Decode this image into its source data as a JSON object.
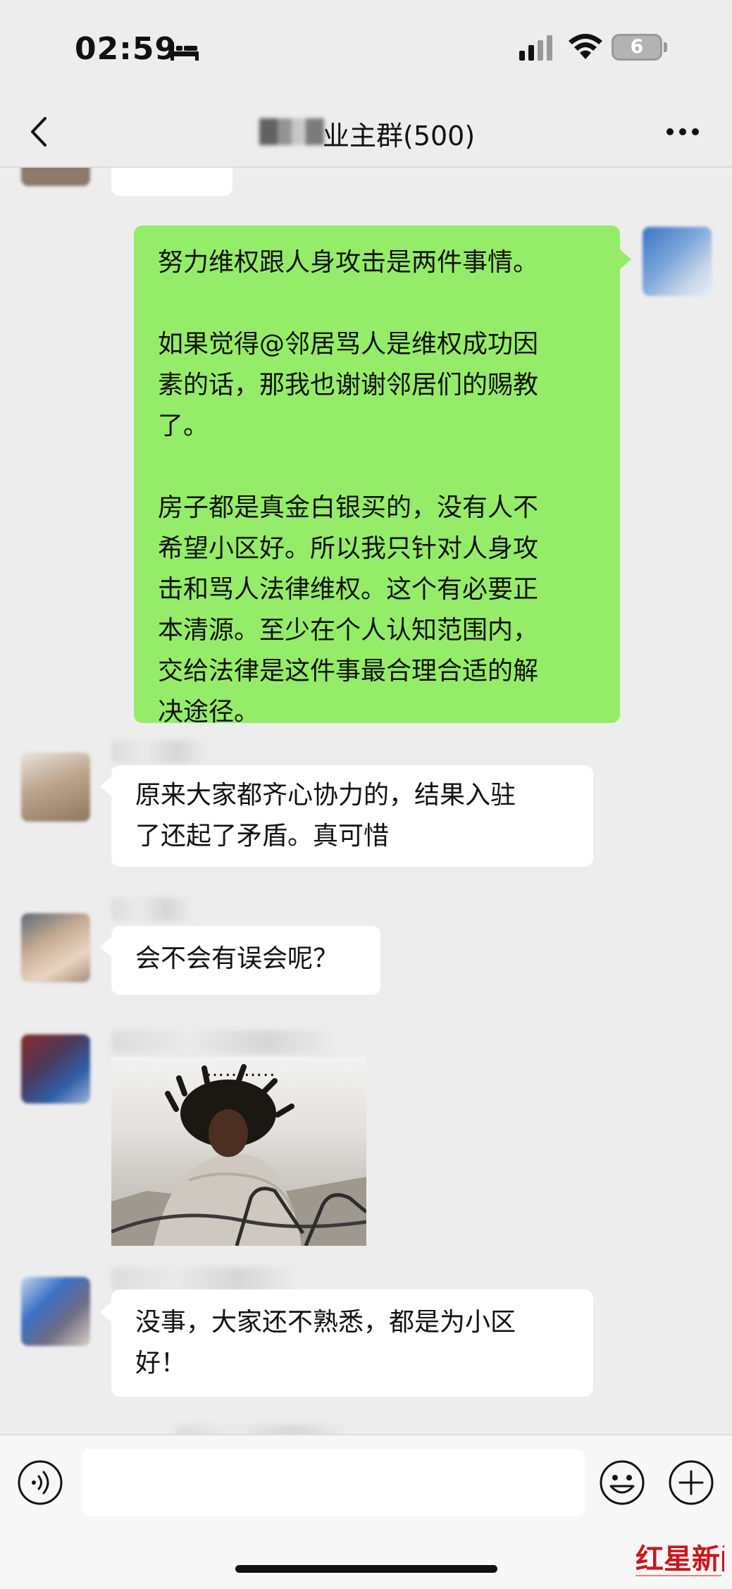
{
  "status_bar": {
    "time": "02:59",
    "battery": "6",
    "icons": [
      "bed-icon",
      "signal-icon",
      "wifi-icon",
      "battery-icon"
    ]
  },
  "nav": {
    "title": "业主群(500)",
    "icons": [
      "back-icon",
      "more-icon"
    ]
  },
  "messages": [
    {
      "side": "right",
      "type": "text",
      "paragraphs": [
        "努力维权跟人身攻击是两件事情。",
        "如果觉得@邻居骂人是维权成功因\n素的话，那我也谢谢邻居们的赐教\n了。",
        "房子都是真金白银买的，没有人不\n希望小区好。所以我只针对人身攻\n击和骂人法律维权。这个有必要正\n本清源。至少在个人认知范围内，\n交给法律是这件事最合理合适的解\n决途径。"
      ]
    },
    {
      "side": "left",
      "type": "text",
      "text": "原来大家都齐心协力的，结果入驻\n了还起了矛盾。真可惜"
    },
    {
      "side": "left",
      "type": "text",
      "text": "会不会有误会呢？"
    },
    {
      "side": "left",
      "type": "image",
      "caption": "……….."
    },
    {
      "side": "left",
      "type": "text",
      "text": "没事，大家还不熟悉，都是为小区\n好！"
    }
  ],
  "input_bar": {
    "placeholder": "",
    "icons": [
      "voice-icon",
      "emoji-icon",
      "plus-icon"
    ]
  },
  "watermark": {
    "text": "红星新闻"
  },
  "colors": {
    "background": "#ededed",
    "own_bubble": "#95ec69",
    "other_bubble": "#ffffff",
    "watermark": "#c8171c"
  }
}
